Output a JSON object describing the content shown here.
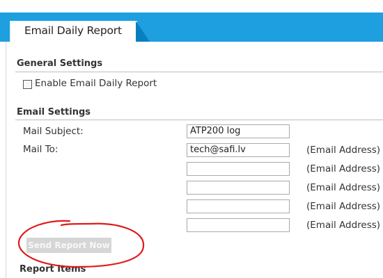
{
  "page": {
    "tab_title": "Email Daily Report"
  },
  "general": {
    "title": "General Settings",
    "enable_label": "Enable Email Daily Report",
    "enable_checked": false
  },
  "email": {
    "title": "Email Settings",
    "subject_label": "Mail Subject:",
    "subject_value": "ATP200 log",
    "to_label": "Mail To:",
    "recipients": [
      "tech@safi.lv",
      "",
      "",
      "",
      ""
    ],
    "hint": "(Email Address)"
  },
  "actions": {
    "send_label": "Send Report Now"
  },
  "next_section": {
    "title_partial": "Report Items"
  },
  "colors": {
    "accent": "#1d9fe0",
    "annotation": "#e01a1a"
  }
}
